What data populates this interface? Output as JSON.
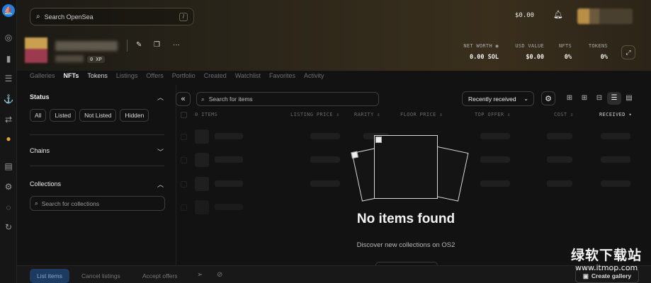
{
  "app": {
    "accent": "#2081e2",
    "brand": "OpenSea"
  },
  "rail": {
    "icons": [
      "opensea-logo-icon",
      "compass-icon",
      "chart-icon",
      "list-icon",
      "anchor-icon",
      "swap-icon",
      "avatar-icon",
      "document-icon",
      "settings-icon",
      "support-icon",
      "refresh-icon"
    ]
  },
  "header": {
    "search_placeholder": "Search OpenSea",
    "search_shortcut": "/",
    "wallet_balance": "$0.00"
  },
  "profile": {
    "xp_label": "0 XP",
    "stats": [
      {
        "label": "NET WORTH",
        "value": "0.00 SOL"
      },
      {
        "label": "USD VALUE",
        "value": "$0.00"
      },
      {
        "label": "NFTS",
        "value": "0%"
      },
      {
        "label": "TOKENS",
        "value": "0%"
      }
    ]
  },
  "tabs": [
    {
      "label": "Galleries",
      "active": false
    },
    {
      "label": "NFTs",
      "active": true
    },
    {
      "label": "Tokens",
      "active": false
    },
    {
      "label": "Listings",
      "active": false
    },
    {
      "label": "Offers",
      "active": false
    },
    {
      "label": "Portfolio",
      "active": false
    },
    {
      "label": "Created",
      "active": false
    },
    {
      "label": "Watchlist",
      "active": false
    },
    {
      "label": "Favorites",
      "active": false
    },
    {
      "label": "Activity",
      "active": false
    }
  ],
  "filters": {
    "status_title": "Status",
    "status_chips": [
      "All",
      "Listed",
      "Not Listed",
      "Hidden"
    ],
    "chains_title": "Chains",
    "collections_title": "Collections",
    "collections_placeholder": "Search for collections"
  },
  "toolbar": {
    "collapse_icon": "«",
    "items_placeholder": "Search for items",
    "sort_label": "Recently received"
  },
  "table": {
    "columns": [
      "0 ITEMS",
      "LISTING PRICE ⇕",
      "RARITY ⇕",
      "FLOOR PRICE ⇕",
      "TOP OFFER ⇕",
      "COST ⇕",
      "RECEIVED ▾"
    ]
  },
  "empty": {
    "title": "No items found",
    "subtitle": "Discover new collections on OS2"
  },
  "bottom_bar": {
    "list_items": "List items",
    "cancel_listings": "Cancel listings",
    "accept_offers": "Accept offers",
    "create_gallery": "Create gallery"
  },
  "watermark": {
    "line1": "绿软下载站",
    "line2": "www.itmop.com"
  }
}
